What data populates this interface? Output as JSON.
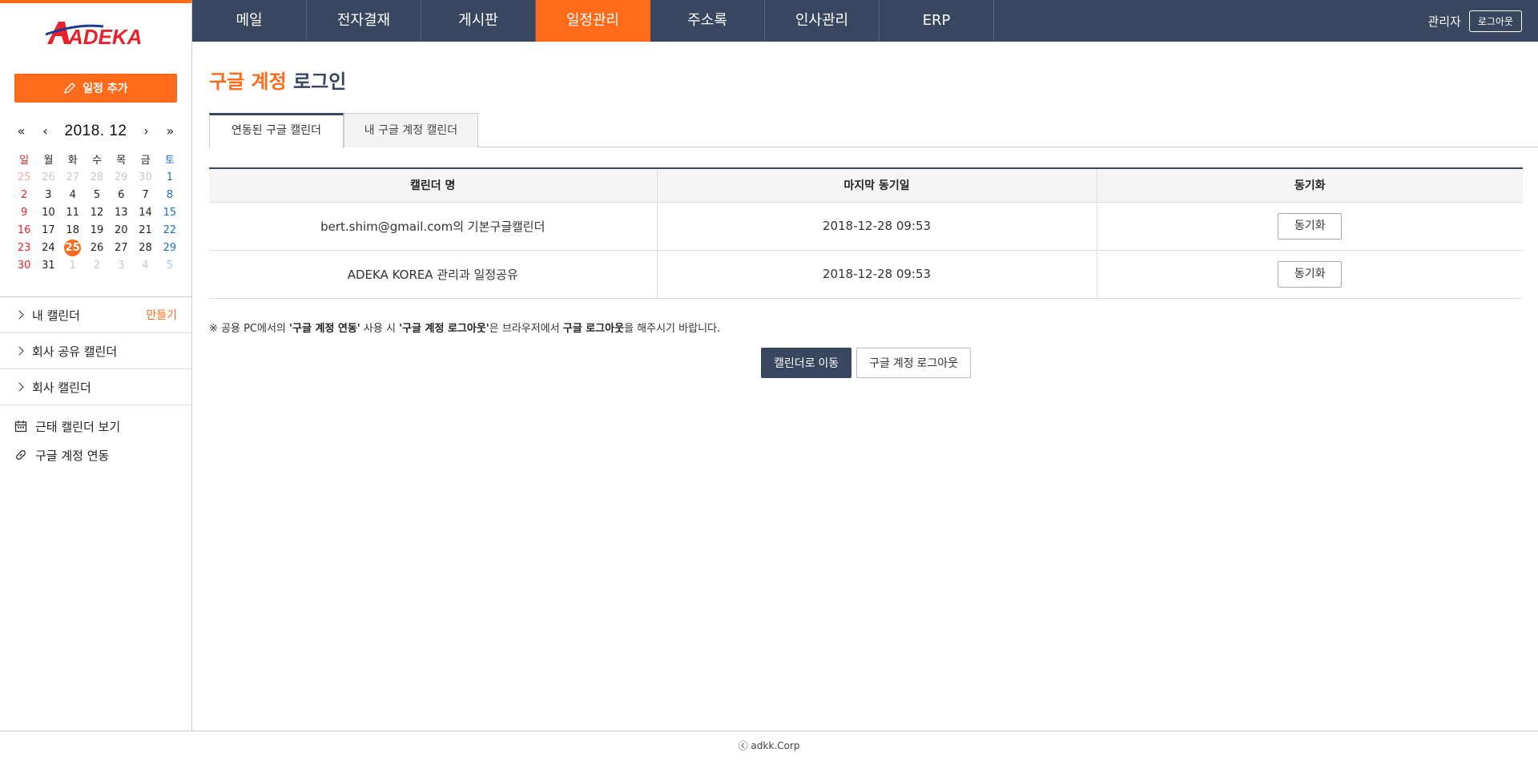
{
  "app": {
    "logo_text": "ADEKA",
    "accent": "#ff6b1a",
    "nav_bg": "#38465f"
  },
  "topnav": {
    "tabs": [
      {
        "label": "메일"
      },
      {
        "label": "전자결재"
      },
      {
        "label": "게시판"
      },
      {
        "label": "일정관리",
        "active": true
      },
      {
        "label": "주소록"
      },
      {
        "label": "인사관리"
      },
      {
        "label": "ERP"
      }
    ],
    "user_name": "관리자",
    "logout_label": "로그아웃"
  },
  "sidebar": {
    "add_label": "일정 추가",
    "calendar": {
      "year_month": "2018. 12",
      "weekdays": [
        "일",
        "월",
        "화",
        "수",
        "목",
        "금",
        "토"
      ],
      "weeks": [
        [
          "25",
          "26",
          "27",
          "28",
          "29",
          "30",
          "1"
        ],
        [
          "2",
          "3",
          "4",
          "5",
          "6",
          "7",
          "8"
        ],
        [
          "9",
          "10",
          "11",
          "12",
          "13",
          "14",
          "15"
        ],
        [
          "16",
          "17",
          "18",
          "19",
          "20",
          "21",
          "22"
        ],
        [
          "23",
          "24",
          "25",
          "26",
          "27",
          "28",
          "29"
        ],
        [
          "30",
          "31",
          "1",
          "2",
          "3",
          "4",
          "5"
        ]
      ],
      "today": "25"
    },
    "sections": [
      {
        "label": "내 캘린더",
        "action": "만들기"
      },
      {
        "label": "회사 공유 캘린더"
      },
      {
        "label": "회사 캘린더"
      }
    ],
    "links": [
      {
        "label": "근태 캘린더 보기",
        "icon": "calendar-icon"
      },
      {
        "label": "구글 계정 연동",
        "icon": "link-icon"
      }
    ]
  },
  "main": {
    "title_highlight": "구글 계정",
    "title_rest": " 로그인",
    "tabs": [
      "연동된 구글 캘린더",
      "내 구글 계정 캘린더"
    ],
    "table": {
      "headers": [
        "캘린더 명",
        "마지막 동기일",
        "동기화"
      ],
      "rows": [
        {
          "name": "bert.shim@gmail.com의 기본구글캘린더",
          "last_sync": "2018-12-28  09:53",
          "action": "동기화"
        },
        {
          "name": "ADEKA KOREA 관리과 일정공유",
          "last_sync": "2018-12-28  09:53",
          "action": "동기화"
        }
      ]
    },
    "notice": {
      "p1": "※ 공용 PC에서의 ",
      "b1": "'구글 계정 연동'",
      "p2": " 사용 시 ",
      "b2": "'구글 계정 로그아웃'",
      "p3": "은 브라우저에서 ",
      "b3": "구글 로그아웃",
      "p4": "을 해주시기 바랍니다."
    },
    "primary_button": "캘린더로 이동",
    "secondary_button": "구글 계정 로그아웃"
  },
  "footer": {
    "text": "ⓒ adkk.Corp"
  }
}
